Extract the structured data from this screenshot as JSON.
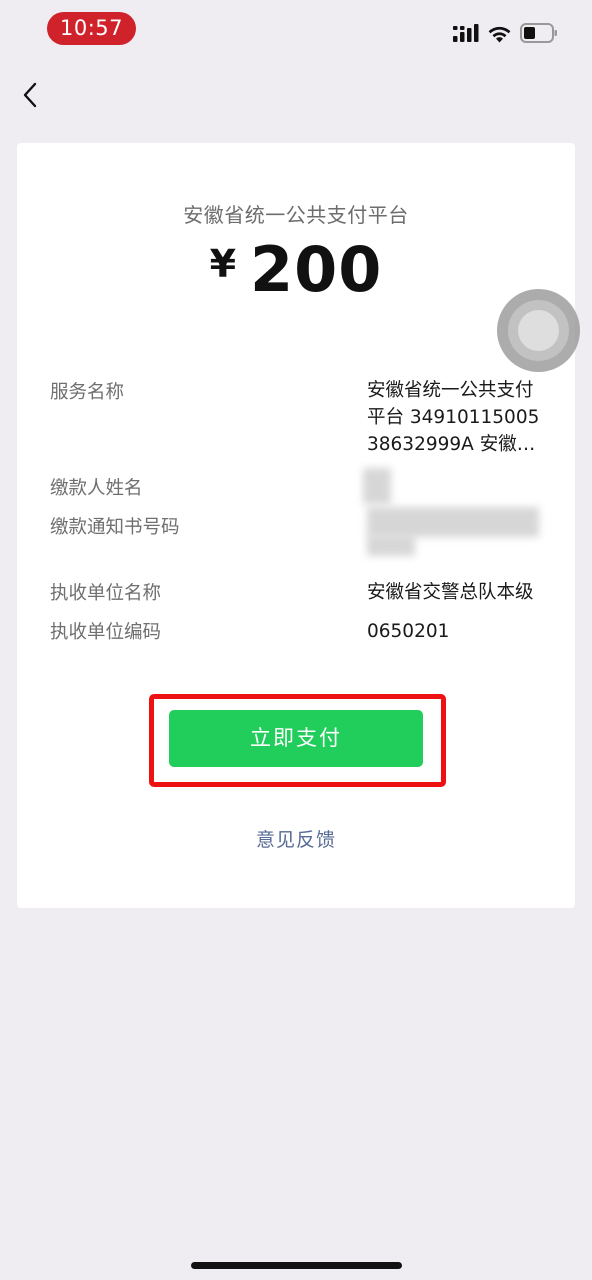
{
  "status_bar": {
    "time": "10:57",
    "icons": [
      "signal-icon",
      "wifi-icon",
      "battery-icon"
    ]
  },
  "nav": {
    "back_icon": "chevron-left-icon"
  },
  "payment": {
    "merchant": "安徽省统一公共支付平台",
    "currency": "¥",
    "amount": "200"
  },
  "details": {
    "service_name": {
      "label": "服务名称",
      "value": "安徽省统一公共支付平台 3491011500538632999A 安徽…"
    },
    "payer_name": {
      "label": "缴款人姓名",
      "value": ""
    },
    "notice_number": {
      "label": "缴款通知书号码",
      "value": ""
    },
    "collector_name": {
      "label": "执收单位名称",
      "value": "安徽省交警总队本级"
    },
    "collector_code": {
      "label": "执收单位编码",
      "value": "0650201"
    }
  },
  "actions": {
    "pay_label": "立即支付",
    "feedback_label": "意见反馈"
  },
  "colors": {
    "pay_button": "#21cd5b",
    "highlight_border": "#ee1111",
    "time_pill": "#d0222b",
    "link": "#576b95"
  }
}
